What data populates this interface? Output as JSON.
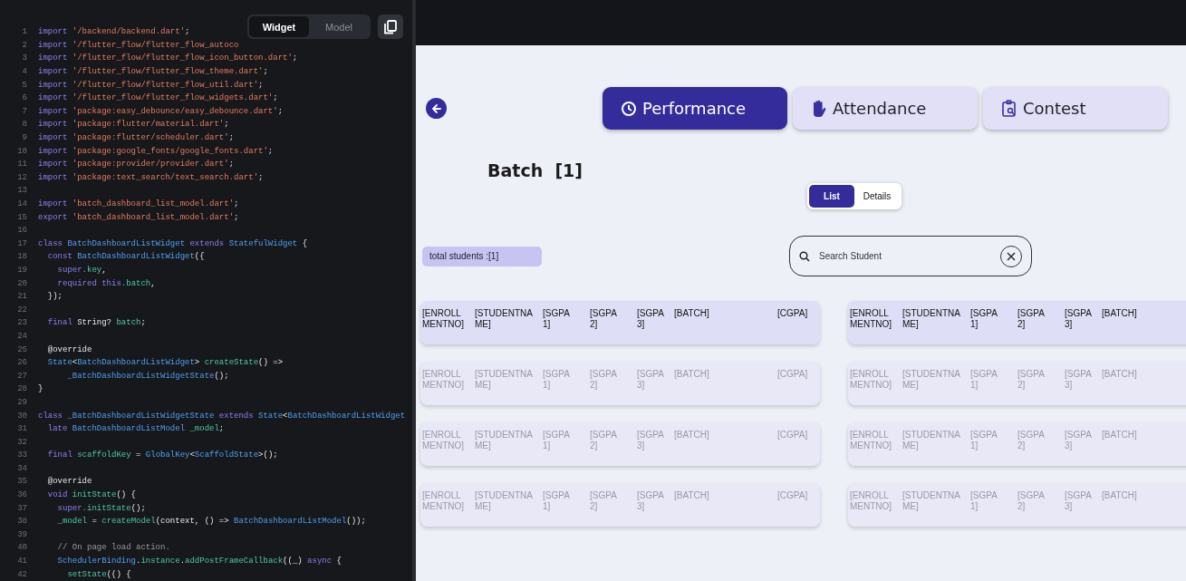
{
  "code_editor": {
    "view_toggle": [
      {
        "label": "Widget",
        "selected": true
      },
      {
        "label": "Model",
        "selected": false
      }
    ],
    "lines": [
      {
        "number": "1",
        "tokens": [
          {
            "kind": "k",
            "text": "import "
          },
          {
            "kind": "s",
            "text": "'/backend/backend.dart'"
          },
          {
            "kind": "p",
            "text": ";"
          }
        ]
      },
      {
        "number": "2",
        "tokens": [
          {
            "kind": "k",
            "text": "import "
          },
          {
            "kind": "s",
            "text": "'/flutter_flow/flutter_flow_autoco"
          }
        ]
      },
      {
        "number": "3",
        "tokens": [
          {
            "kind": "k",
            "text": "import "
          },
          {
            "kind": "s",
            "text": "'/flutter_flow/flutter_flow_icon_button.dart'"
          },
          {
            "kind": "p",
            "text": ";"
          }
        ]
      },
      {
        "number": "4",
        "tokens": [
          {
            "kind": "k",
            "text": "import "
          },
          {
            "kind": "s",
            "text": "'/flutter_flow/flutter_flow_theme.dart'"
          },
          {
            "kind": "p",
            "text": ";"
          }
        ]
      },
      {
        "number": "5",
        "tokens": [
          {
            "kind": "k",
            "text": "import "
          },
          {
            "kind": "s",
            "text": "'/flutter_flow/flutter_flow_util.dart'"
          },
          {
            "kind": "p",
            "text": ";"
          }
        ]
      },
      {
        "number": "6",
        "tokens": [
          {
            "kind": "k",
            "text": "import "
          },
          {
            "kind": "s",
            "text": "'/flutter_flow/flutter_flow_widgets.dart'"
          },
          {
            "kind": "p",
            "text": ";"
          }
        ]
      },
      {
        "number": "7",
        "tokens": [
          {
            "kind": "k",
            "text": "import "
          },
          {
            "kind": "s",
            "text": "'package:easy_debounce/easy_debounce.dart'"
          },
          {
            "kind": "p",
            "text": ";"
          }
        ]
      },
      {
        "number": "8",
        "tokens": [
          {
            "kind": "k",
            "text": "import "
          },
          {
            "kind": "s",
            "text": "'package:flutter/material.dart'"
          },
          {
            "kind": "p",
            "text": ";"
          }
        ]
      },
      {
        "number": "9",
        "tokens": [
          {
            "kind": "k",
            "text": "import "
          },
          {
            "kind": "s",
            "text": "'package:flutter/scheduler.dart'"
          },
          {
            "kind": "p",
            "text": ";"
          }
        ]
      },
      {
        "number": "10",
        "tokens": [
          {
            "kind": "k",
            "text": "import "
          },
          {
            "kind": "s",
            "text": "'package:google_fonts/google_fonts.dart'"
          },
          {
            "kind": "p",
            "text": ";"
          }
        ]
      },
      {
        "number": "11",
        "tokens": [
          {
            "kind": "k",
            "text": "import "
          },
          {
            "kind": "s",
            "text": "'package:provider/provider.dart'"
          },
          {
            "kind": "p",
            "text": ";"
          }
        ]
      },
      {
        "number": "12",
        "tokens": [
          {
            "kind": "k",
            "text": "import "
          },
          {
            "kind": "s",
            "text": "'package:text_search/text_search.dart'"
          },
          {
            "kind": "p",
            "text": ";"
          }
        ]
      },
      {
        "number": "13"
      },
      {
        "number": "14",
        "tokens": [
          {
            "kind": "k",
            "text": "import "
          },
          {
            "kind": "s",
            "text": "'batch_dashboard_list_model.dart'"
          },
          {
            "kind": "p",
            "text": ";"
          }
        ]
      },
      {
        "number": "15",
        "tokens": [
          {
            "kind": "k",
            "text": "export "
          },
          {
            "kind": "s",
            "text": "'batch_dashboard_list_model.dart'"
          },
          {
            "kind": "p",
            "text": ";"
          }
        ]
      },
      {
        "number": "16"
      },
      {
        "number": "17",
        "tokens": [
          {
            "kind": "k",
            "text": "class "
          },
          {
            "kind": "t",
            "text": "BatchDashboardListWidget "
          },
          {
            "kind": "k",
            "text": "extends "
          },
          {
            "kind": "t",
            "text": "StatefulWidget "
          },
          {
            "kind": "p",
            "text": "{"
          }
        ]
      },
      {
        "number": "18",
        "tokens": [
          {
            "kind": "k",
            "text": "  const "
          },
          {
            "kind": "t",
            "text": "BatchDashboardListWidget"
          },
          {
            "kind": "p",
            "text": "({"
          }
        ]
      },
      {
        "number": "19",
        "tokens": [
          {
            "kind": "k",
            "text": "    super"
          },
          {
            "kind": "f",
            "text": ".key"
          },
          {
            "kind": "p",
            "text": ","
          }
        ]
      },
      {
        "number": "20",
        "tokens": [
          {
            "kind": "k",
            "text": "    required this"
          },
          {
            "kind": "f",
            "text": ".batch"
          },
          {
            "kind": "p",
            "text": ","
          }
        ]
      },
      {
        "number": "21",
        "tokens": [
          {
            "kind": "p",
            "text": "  });"
          }
        ]
      },
      {
        "number": "22"
      },
      {
        "number": "23",
        "tokens": [
          {
            "kind": "k",
            "text": "  final "
          },
          {
            "kind": "p",
            "text": "String? "
          },
          {
            "kind": "f",
            "text": "batch"
          },
          {
            "kind": "p",
            "text": ";"
          }
        ]
      },
      {
        "number": "24"
      },
      {
        "number": "25",
        "tokens": [
          {
            "kind": "p",
            "text": "  @override"
          }
        ]
      },
      {
        "number": "26",
        "tokens": [
          {
            "kind": "t",
            "text": "  State"
          },
          {
            "kind": "p",
            "text": "<"
          },
          {
            "kind": "t",
            "text": "BatchDashboardListWidget"
          },
          {
            "kind": "p",
            "text": "> "
          },
          {
            "kind": "f",
            "text": "createState"
          },
          {
            "kind": "p",
            "text": "() =>"
          }
        ]
      },
      {
        "number": "27",
        "tokens": [
          {
            "kind": "t",
            "text": "      _BatchDashboardListWidgetState"
          },
          {
            "kind": "p",
            "text": "();"
          }
        ]
      },
      {
        "number": "28",
        "tokens": [
          {
            "kind": "p",
            "text": "}"
          }
        ]
      },
      {
        "number": "29"
      },
      {
        "number": "30",
        "tokens": [
          {
            "kind": "k",
            "text": "class "
          },
          {
            "kind": "t",
            "text": "_BatchDashboardListWidgetState "
          },
          {
            "kind": "k",
            "text": "extends "
          },
          {
            "kind": "t",
            "text": "State"
          },
          {
            "kind": "p",
            "text": "<"
          },
          {
            "kind": "t",
            "text": "BatchDashboardListWidget"
          }
        ]
      },
      {
        "number": "31",
        "tokens": [
          {
            "kind": "k",
            "text": "  late "
          },
          {
            "kind": "t",
            "text": "BatchDashboardListModel "
          },
          {
            "kind": "f",
            "text": "_model"
          },
          {
            "kind": "p",
            "text": ";"
          }
        ]
      },
      {
        "number": "32"
      },
      {
        "number": "33",
        "tokens": [
          {
            "kind": "k",
            "text": "  final "
          },
          {
            "kind": "f",
            "text": "scaffoldKey "
          },
          {
            "kind": "p",
            "text": "= "
          },
          {
            "kind": "t",
            "text": "GlobalKey"
          },
          {
            "kind": "p",
            "text": "<"
          },
          {
            "kind": "t",
            "text": "ScaffoldState"
          },
          {
            "kind": "p",
            "text": ">();"
          }
        ]
      },
      {
        "number": "34"
      },
      {
        "number": "35",
        "tokens": [
          {
            "kind": "p",
            "text": "  @override"
          }
        ]
      },
      {
        "number": "36",
        "tokens": [
          {
            "kind": "k",
            "text": "  void "
          },
          {
            "kind": "f",
            "text": "initState"
          },
          {
            "kind": "p",
            "text": "() {"
          }
        ]
      },
      {
        "number": "37",
        "tokens": [
          {
            "kind": "k",
            "text": "    super"
          },
          {
            "kind": "f",
            "text": ".initState"
          },
          {
            "kind": "p",
            "text": "();"
          }
        ]
      },
      {
        "number": "38",
        "tokens": [
          {
            "kind": "f",
            "text": "    _model "
          },
          {
            "kind": "p",
            "text": "= "
          },
          {
            "kind": "f",
            "text": "createModel"
          },
          {
            "kind": "p",
            "text": "(context, () => "
          },
          {
            "kind": "t",
            "text": "BatchDashboardListModel"
          },
          {
            "kind": "p",
            "text": "());"
          }
        ]
      },
      {
        "number": "39"
      },
      {
        "number": "40",
        "tokens": [
          {
            "kind": "c",
            "text": "    // On page load action."
          }
        ]
      },
      {
        "number": "41",
        "tokens": [
          {
            "kind": "t",
            "text": "    SchedulerBinding"
          },
          {
            "kind": "p",
            "text": "."
          },
          {
            "kind": "f",
            "text": "instance"
          },
          {
            "kind": "p",
            "text": "."
          },
          {
            "kind": "f",
            "text": "addPostFrameCallback"
          },
          {
            "kind": "p",
            "text": "((_) "
          },
          {
            "kind": "k",
            "text": "async "
          },
          {
            "kind": "p",
            "text": "{"
          }
        ]
      },
      {
        "number": "42",
        "tokens": [
          {
            "kind": "f",
            "text": "      setState"
          },
          {
            "kind": "p",
            "text": "(() {"
          }
        ]
      }
    ]
  },
  "app": {
    "tabs": [
      {
        "label": "Performance",
        "selected": true
      },
      {
        "label": "Attendance",
        "selected": false
      },
      {
        "label": "Contest",
        "selected": false
      }
    ],
    "title": "Batch  [1]",
    "view_toggle": [
      {
        "label": "List",
        "selected": true
      },
      {
        "label": "Details",
        "selected": false
      }
    ],
    "total_students": "total students :[1]",
    "search": {
      "placeholder": "Search Student"
    },
    "cards": [
      {
        "selected": true,
        "fields": [
          "[ENROLLMENTNO]",
          "[STUDENTNAME]",
          "[SGPA1]",
          "[SGPA2]",
          "[SGPA3]",
          "[BATCH]",
          "[CGPA]"
        ]
      },
      {
        "selected": true,
        "fields": [
          "[ENROLLMENTNO]",
          "[STUDENTNAME]",
          "[SGPA1]",
          "[SGPA2]",
          "[SGPA3]",
          "[BATCH]"
        ]
      },
      {
        "selected": false,
        "fields": [
          "[ENROLLMENTNO]",
          "[STUDENTNAME]",
          "[SGPA1]",
          "[SGPA2]",
          "[SGPA3]",
          "[BATCH]",
          "[CGPA]"
        ]
      },
      {
        "selected": false,
        "fields": [
          "[ENROLLMENTNO]",
          "[STUDENTNAME]",
          "[SGPA1]",
          "[SGPA2]",
          "[SGPA3]",
          "[BATCH]"
        ]
      },
      {
        "selected": false,
        "fields": [
          "[ENROLLMENTNO]",
          "[STUDENTNAME]",
          "[SGPA1]",
          "[SGPA2]",
          "[SGPA3]",
          "[BATCH]",
          "[CGPA]"
        ]
      },
      {
        "selected": false,
        "fields": [
          "[ENROLLMENTNO]",
          "[STUDENTNAME]",
          "[SGPA1]",
          "[SGPA2]",
          "[SGPA3]",
          "[BATCH]"
        ]
      },
      {
        "selected": false,
        "fields": [
          "[ENROLLMENTNO]",
          "[STUDENTNAME]",
          "[SGPA1]",
          "[SGPA2]",
          "[SGPA3]",
          "[BATCH]",
          "[CGPA]"
        ]
      },
      {
        "selected": false,
        "fields": [
          "[ENROLLMENTNO]",
          "[STUDENTNAME]",
          "[SGPA1]",
          "[SGPA2]",
          "[SGPA3]",
          "[BATCH]"
        ]
      }
    ]
  }
}
